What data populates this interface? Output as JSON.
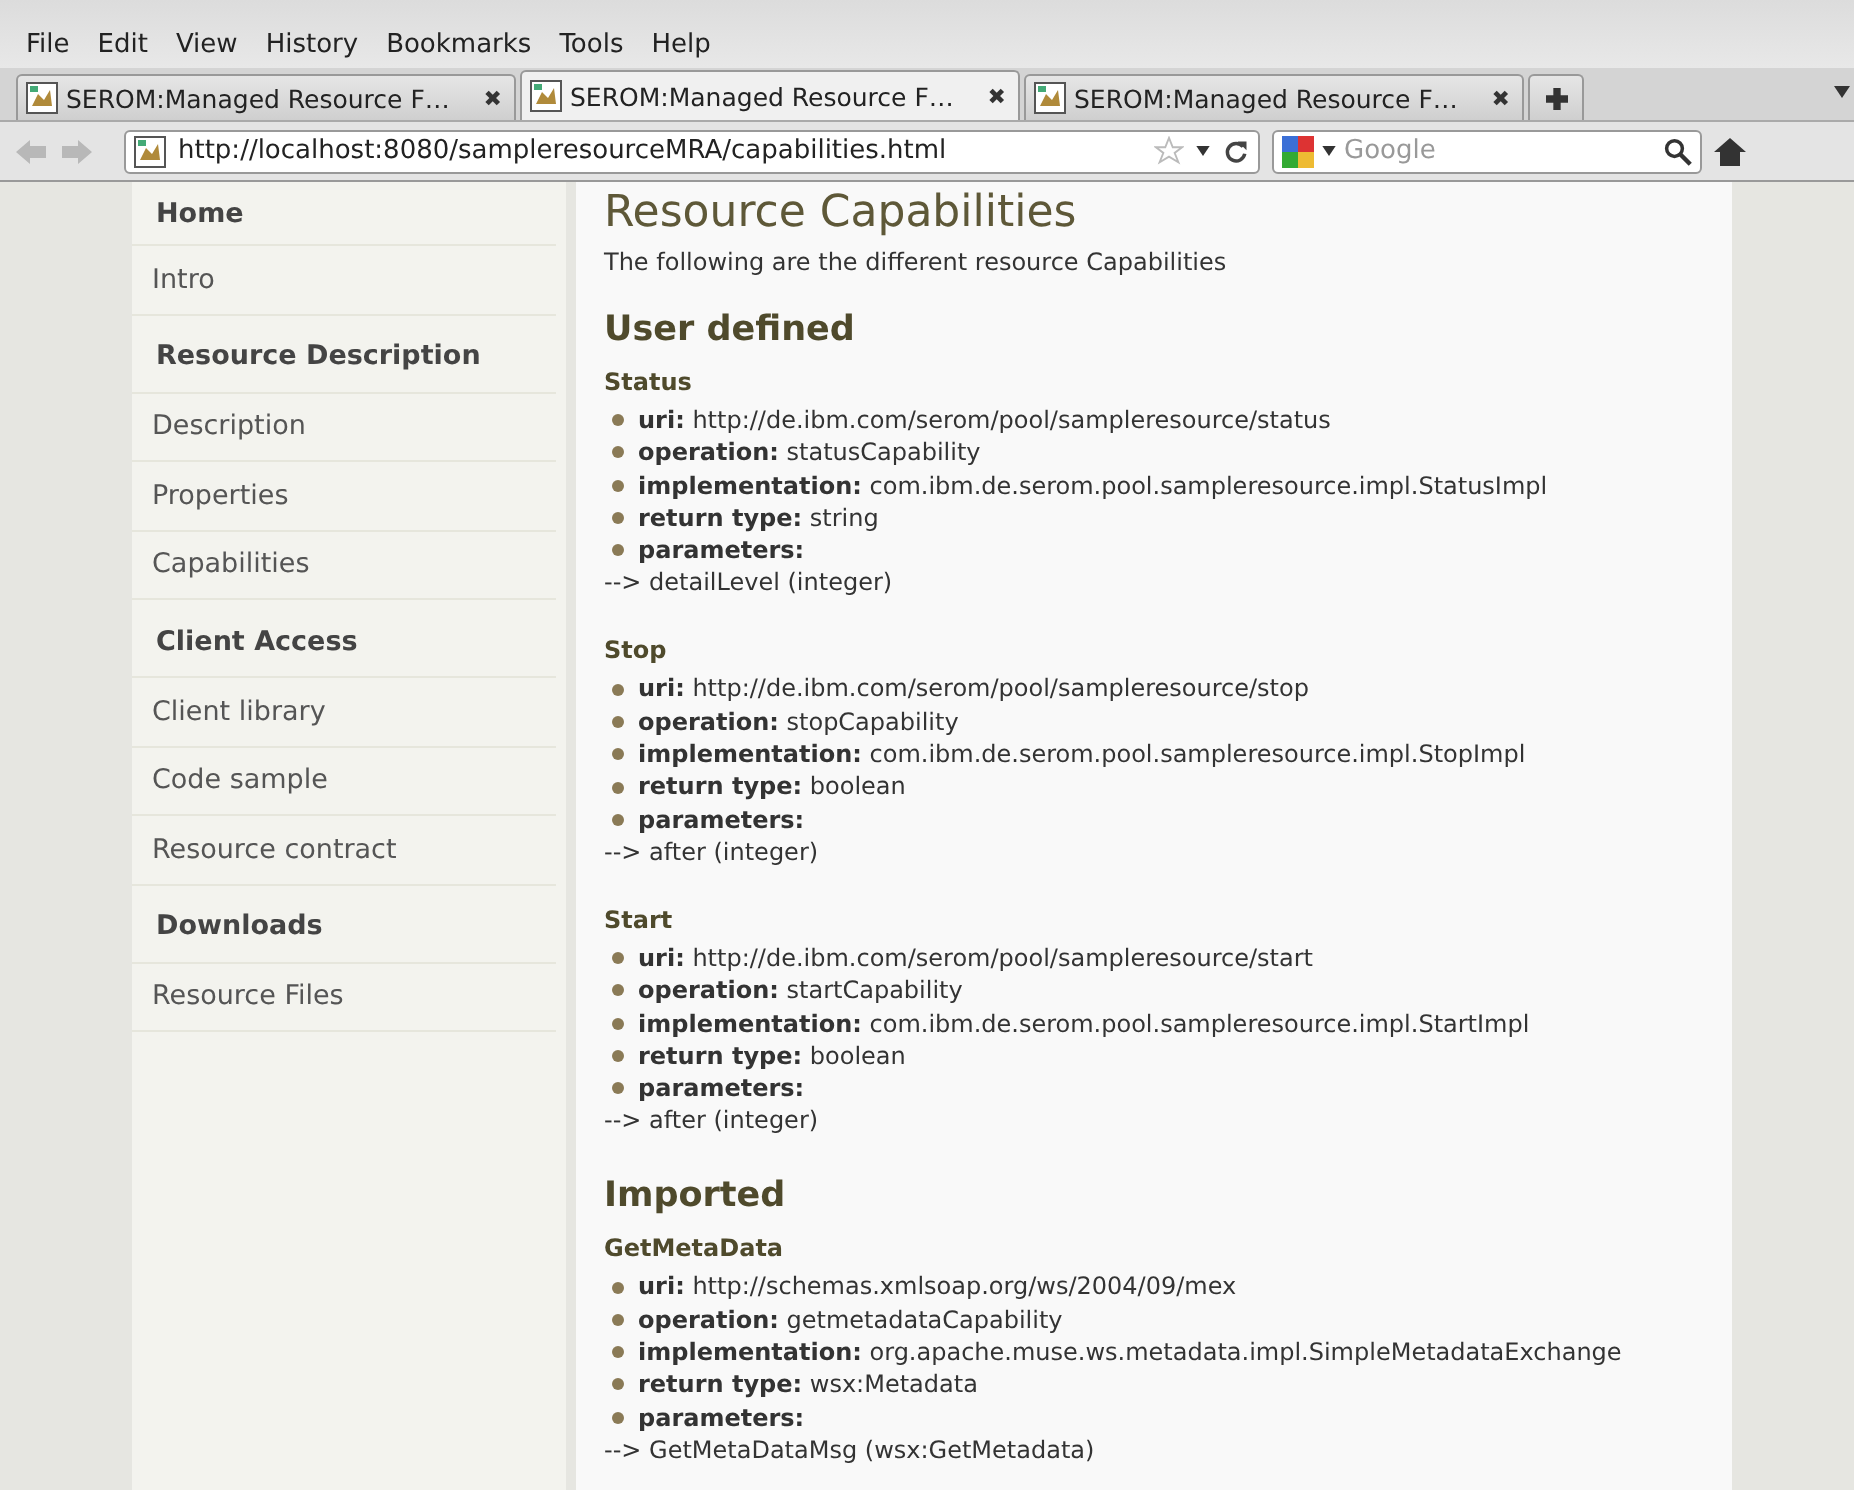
{
  "menu": [
    "File",
    "Edit",
    "View",
    "History",
    "Bookmarks",
    "Tools",
    "Help"
  ],
  "tabs": [
    {
      "title": "SEROM:Managed Resource F…",
      "selected": false
    },
    {
      "title": "SEROM:Managed Resource F…",
      "selected": true
    },
    {
      "title": "SEROM:Managed Resource F…",
      "selected": false
    }
  ],
  "tab_close": "✖",
  "address": {
    "value": "http://localhost:8080/sampleresourceMRA/capabilities.html"
  },
  "search": {
    "placeholder": "Google"
  },
  "sidebar": {
    "items": [
      {
        "label": "Home",
        "kind": "header"
      },
      {
        "label": "Intro",
        "kind": "link"
      },
      {
        "label": "Resource Description",
        "kind": "header"
      },
      {
        "label": "Description",
        "kind": "link"
      },
      {
        "label": "Properties",
        "kind": "link"
      },
      {
        "label": "Capabilities",
        "kind": "link"
      },
      {
        "label": "Client Access",
        "kind": "header"
      },
      {
        "label": "Client library",
        "kind": "link"
      },
      {
        "label": "Code sample",
        "kind": "link"
      },
      {
        "label": "Resource contract",
        "kind": "link"
      },
      {
        "label": "Downloads",
        "kind": "header"
      },
      {
        "label": "Resource Files",
        "kind": "link"
      }
    ]
  },
  "page": {
    "title": "Resource Capabilities",
    "intro": "The following are the different resource Capabilities",
    "groups": [
      {
        "heading": "User defined",
        "capabilities": [
          {
            "name": "Status",
            "fields": [
              {
                "label": "uri:",
                "value": "http://de.ibm.com/serom/pool/sampleresource/status"
              },
              {
                "label": "operation:",
                "value": "statusCapability"
              },
              {
                "label": "implementation:",
                "value": "com.ibm.de.serom.pool.sampleresource.impl.StatusImpl"
              },
              {
                "label": "return type:",
                "value": "string"
              },
              {
                "label": "parameters:"
              }
            ],
            "params": [
              "--> detailLevel (integer)"
            ]
          },
          {
            "name": "Stop",
            "fields": [
              {
                "label": "uri:",
                "value": "http://de.ibm.com/serom/pool/sampleresource/stop"
              },
              {
                "label": "operation:",
                "value": "stopCapability"
              },
              {
                "label": "implementation:",
                "value": "com.ibm.de.serom.pool.sampleresource.impl.StopImpl"
              },
              {
                "label": "return type:",
                "value": "boolean"
              },
              {
                "label": "parameters:"
              }
            ],
            "params": [
              "--> after (integer)"
            ]
          },
          {
            "name": "Start",
            "fields": [
              {
                "label": "uri:",
                "value": "http://de.ibm.com/serom/pool/sampleresource/start"
              },
              {
                "label": "operation:",
                "value": "startCapability"
              },
              {
                "label": "implementation:",
                "value": "com.ibm.de.serom.pool.sampleresource.impl.StartImpl"
              },
              {
                "label": "return type:",
                "value": "boolean"
              },
              {
                "label": "parameters:"
              }
            ],
            "params": [
              "--> after (integer)"
            ]
          }
        ]
      },
      {
        "heading": "Imported",
        "capabilities": [
          {
            "name": "GetMetaData",
            "fields": [
              {
                "label": "uri:",
                "value": "http://schemas.xmlsoap.org/ws/2004/09/mex"
              },
              {
                "label": "operation:",
                "value": "getmetadataCapability"
              },
              {
                "label": "implementation:",
                "value": "org.apache.muse.ws.metadata.impl.SimpleMetadataExchange"
              },
              {
                "label": "return type:",
                "value": "wsx:Metadata"
              },
              {
                "label": "parameters:"
              }
            ],
            "params": [
              "--> GetMetaDataMsg (wsx:GetMetadata)"
            ]
          }
        ]
      }
    ]
  }
}
